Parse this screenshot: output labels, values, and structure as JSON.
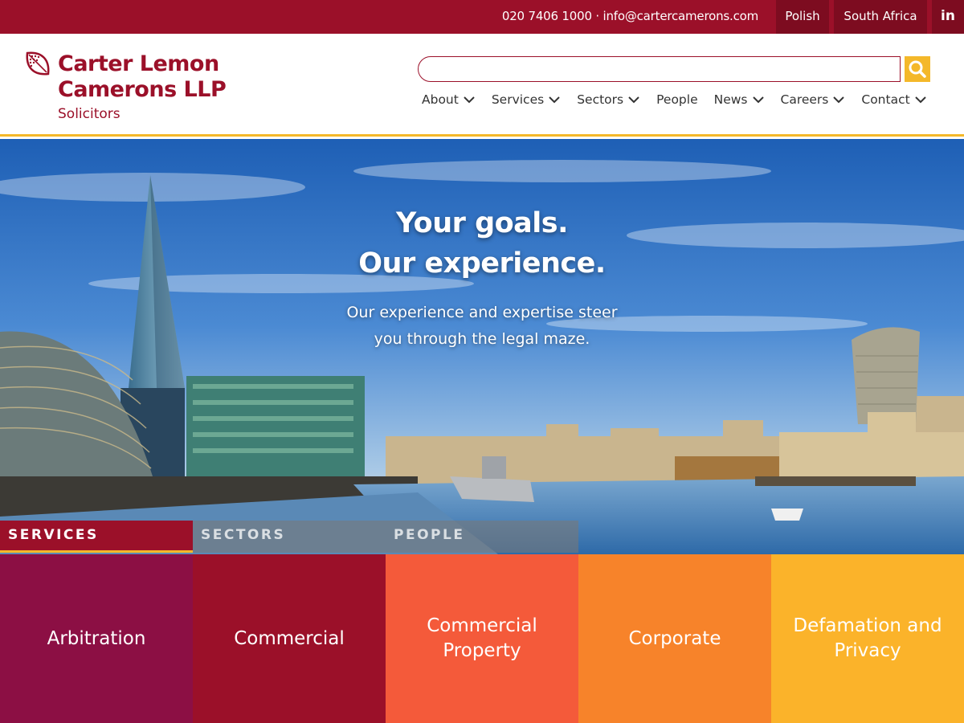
{
  "topbar": {
    "contact": "020 7406 1000 · info@cartercamerons.com",
    "languages": [
      "Polish",
      "South Africa"
    ],
    "social": "in"
  },
  "logo": {
    "line1": "Carter Lemon",
    "line2": "Camerons LLP",
    "tagline": "Solicitors"
  },
  "search": {
    "value": "",
    "placeholder": ""
  },
  "nav": [
    {
      "label": "About",
      "dropdown": true
    },
    {
      "label": "Services",
      "dropdown": true
    },
    {
      "label": "Sectors",
      "dropdown": true
    },
    {
      "label": "People",
      "dropdown": false
    },
    {
      "label": "News",
      "dropdown": true
    },
    {
      "label": "Careers",
      "dropdown": true
    },
    {
      "label": "Contact",
      "dropdown": true
    }
  ],
  "hero": {
    "title_line1": "Your goals.",
    "title_line2": "Our experience.",
    "subtitle_line1": "Our experience and expertise steer",
    "subtitle_line2": "you through the legal maze."
  },
  "tabs": [
    {
      "label": "SERVICES",
      "active": true
    },
    {
      "label": "SECTORS",
      "active": false
    },
    {
      "label": "PEOPLE",
      "active": false
    }
  ],
  "tiles": [
    {
      "label": "Arbitration",
      "color": "#8c0f44"
    },
    {
      "label": "Commercial",
      "color": "#9b1029"
    },
    {
      "label": "Commercial Property",
      "color": "#f45a3a"
    },
    {
      "label": "Corporate",
      "color": "#f7832a"
    },
    {
      "label": "Defamation and Privacy",
      "color": "#fbb32a"
    }
  ],
  "colors": {
    "brand": "#9b1029",
    "accent": "#f4b82a"
  }
}
